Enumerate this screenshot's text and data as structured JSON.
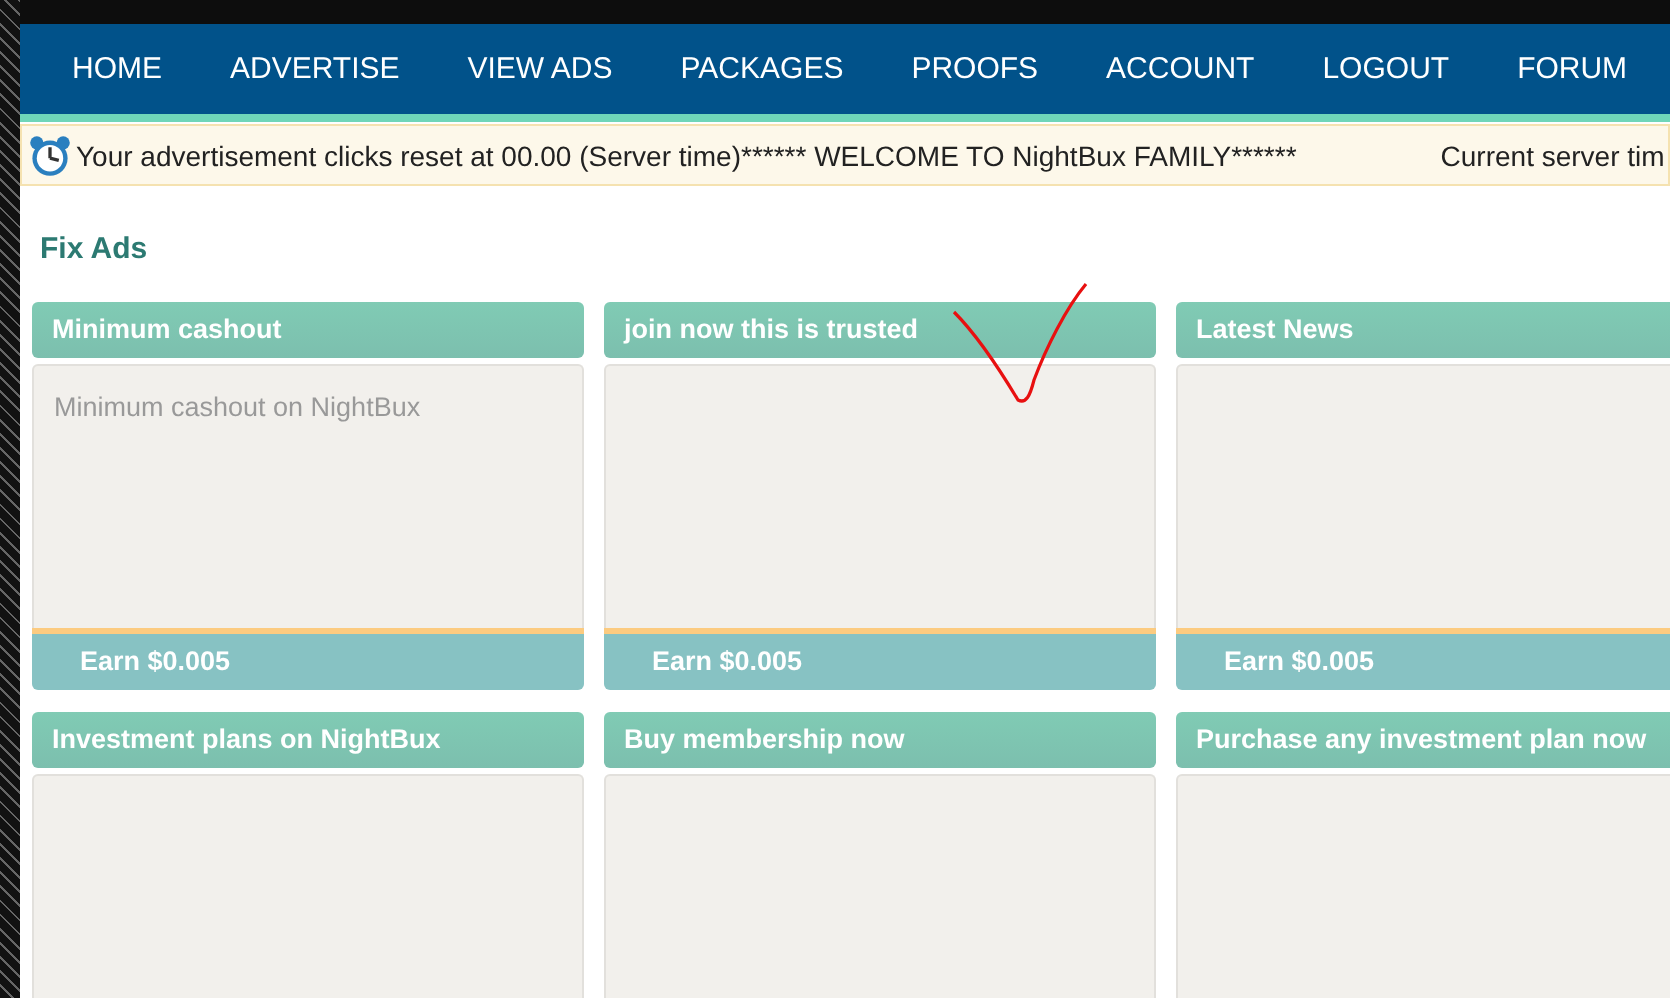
{
  "nav": {
    "items": [
      {
        "label": "HOME"
      },
      {
        "label": "ADVERTISE"
      },
      {
        "label": "VIEW ADS"
      },
      {
        "label": "PACKAGES"
      },
      {
        "label": "PROOFS"
      },
      {
        "label": "ACCOUNT"
      },
      {
        "label": "LOGOUT"
      },
      {
        "label": "FORUM"
      }
    ]
  },
  "notice": {
    "message": "Your advertisement clicks reset at 00.00 (Server time)****** WELCOME TO NightBux FAMILY******",
    "server_time": "Current server tim"
  },
  "section_title": "Fix Ads",
  "ads": [
    {
      "title": "Minimum cashout",
      "description": "Minimum cashout on NightBux",
      "reward": "Earn $0.005"
    },
    {
      "title": "join now this is trusted",
      "reward": "Earn $0.005"
    },
    {
      "title": "Latest News",
      "reward": "Earn $0.005"
    },
    {
      "title": "Investment plans on NightBux"
    },
    {
      "title": "Buy membership now"
    },
    {
      "title": "Purchase any investment plan now"
    }
  ],
  "annotations": [
    {
      "kind": "check"
    }
  ]
}
